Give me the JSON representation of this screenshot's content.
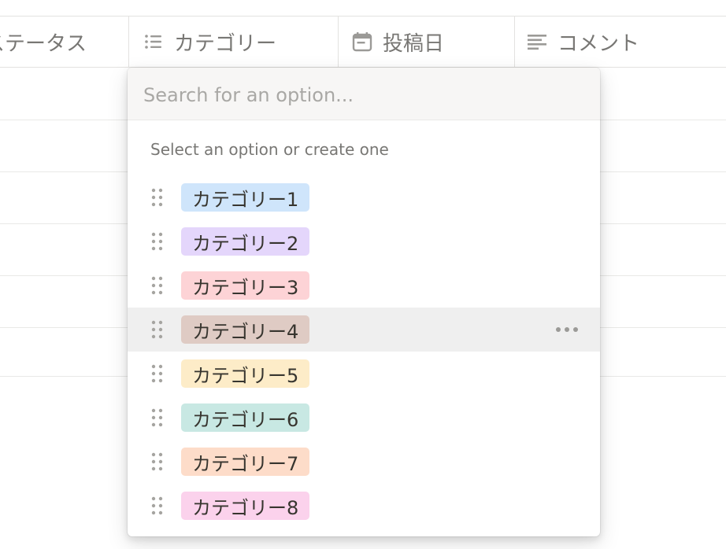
{
  "table": {
    "columns": [
      {
        "label": "ステータス",
        "icon": "status-icon"
      },
      {
        "label": "カテゴリー",
        "icon": "list-icon"
      },
      {
        "label": "投稿日",
        "icon": "calendar-icon"
      },
      {
        "label": "コメント",
        "icon": "text-lines-icon"
      }
    ]
  },
  "popup": {
    "search_placeholder": "Search for an option...",
    "search_value": "",
    "hint": "Select an option or create one",
    "options": [
      {
        "label": "カテゴリー1",
        "color": "#d3e5ef"
      },
      {
        "label": "カテゴリー2",
        "color": "#e8deee"
      },
      {
        "label": "カテゴリー3",
        "color": "#ffe2dd"
      },
      {
        "label": "カテゴリー4",
        "color": "#e0d6d0",
        "hovered": true
      },
      {
        "label": "カテゴリー5",
        "color": "#fdecc8"
      },
      {
        "label": "カテゴリー6",
        "color": "#dbeddb"
      },
      {
        "label": "カテゴリー7",
        "color": "#fadec9"
      },
      {
        "label": "カテゴリー8",
        "color": "#f5e0e9"
      }
    ]
  },
  "colors": {
    "tag1": "#cfe5fb",
    "tag2": "#e4d6fb",
    "tag3": "#fdd3d6",
    "tag4": "#dfcbc4",
    "tag5": "#fdecc8",
    "tag6": "#c8e8e3",
    "tag7": "#fddcc9",
    "tag8": "#fbd2ec"
  }
}
